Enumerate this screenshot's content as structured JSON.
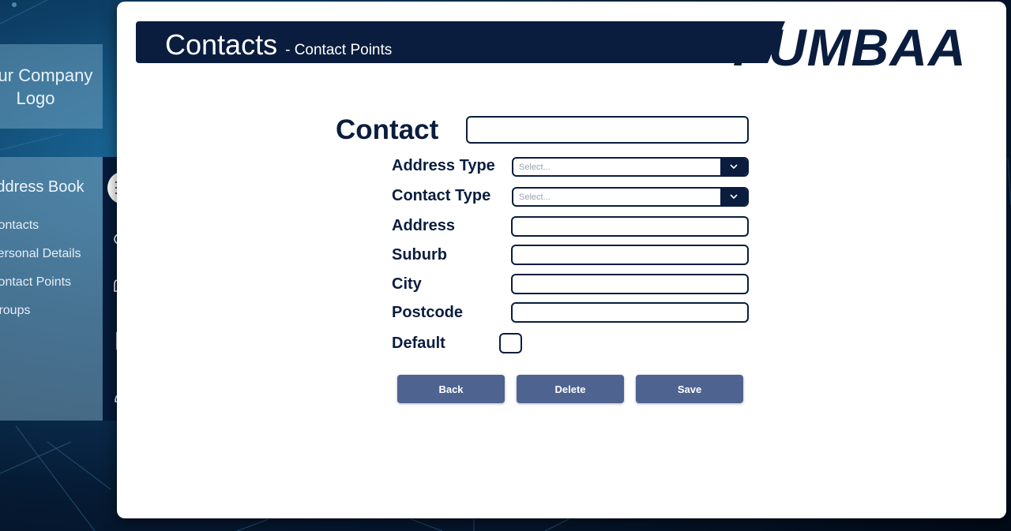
{
  "sidebar": {
    "logo_text": "Your Company Logo",
    "section_title": "Address Book",
    "items": [
      {
        "label": "Contacts"
      },
      {
        "label": "Personal Details"
      },
      {
        "label": "Contact Points"
      },
      {
        "label": "Groups"
      }
    ],
    "rail_icons": [
      "address-book-icon",
      "scroll-icon",
      "mailbox-icon",
      "clipboard-icon",
      "user-icon"
    ]
  },
  "header": {
    "title": "Contacts",
    "subtitle": "- Contact Points",
    "brand": "PUMBAA"
  },
  "form": {
    "contact_label": "Contact",
    "contact_value": "",
    "address_type_label": "Address Type",
    "address_type_value": "Select...",
    "contact_type_label": "Contact Type",
    "contact_type_value": "Select...",
    "address_label": "Address",
    "address_value": "",
    "suburb_label": "Suburb",
    "suburb_value": "",
    "city_label": "City",
    "city_value": "",
    "postcode_label": "Postcode",
    "postcode_value": "",
    "default_label": "Default",
    "default_checked": false
  },
  "buttons": {
    "back": "Back",
    "delete": "Delete",
    "save": "Save"
  },
  "colors": {
    "navy": "#0a1d3e",
    "button": "#4f6390"
  }
}
